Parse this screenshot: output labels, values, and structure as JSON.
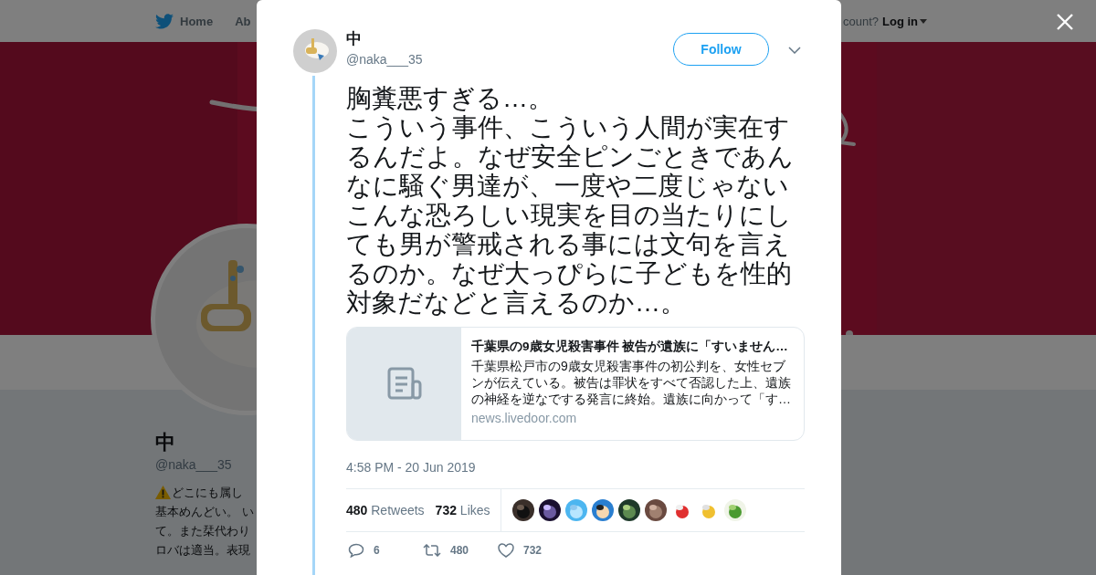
{
  "background_page": {
    "nav": {
      "items": [
        {
          "kind": "home",
          "label": "Home"
        },
        {
          "kind": "plain",
          "label": "Ab"
        }
      ],
      "account_prompt": "count?",
      "login": "Log in"
    },
    "profile": {
      "name": "中",
      "handle": "@naka___35",
      "bio_lines": [
        "どこにも属し",
        "基本めんどい。 い",
        "て。また栞代わり",
        "ロバは適当。表現"
      ]
    }
  },
  "tweet": {
    "author": {
      "name": "中",
      "handle": "@naka___35"
    },
    "follow_button": "Follow",
    "text_lines": [
      "胸糞悪すぎる…。",
      "こういう事件、こういう人間が実在するんだよ。なぜ安全ピンごときであんなに騒ぐ男達が、一度や二度じゃないこんな恐ろしい現実を目の当たりにしても男が警戒される事には文句を言えるのか。なぜ大っぴらに子どもを性的対象だなどと言えるのか…。"
    ],
    "card": {
      "title": "千葉県の9歳女児殺害事件 被告が遺族に「すいません…",
      "description": "千葉県松戸市の9歳女児殺害事件の初公判を、女性セブンが伝えている。被告は罪状をすべて否認した上、遺族の神経を逆なでする発言に終始。遺族に向かって「す…",
      "domain": "news.livedoor.com"
    },
    "timestamp": "4:58 PM - 20 Jun 2019",
    "stats": [
      {
        "count": "480",
        "label": "Retweets"
      },
      {
        "count": "732",
        "label": "Likes"
      }
    ],
    "liker_avatars": [
      {
        "kind": "picture"
      },
      {
        "kind": "picture"
      },
      {
        "kind": "picture"
      },
      {
        "kind": "picture"
      },
      {
        "kind": "picture"
      },
      {
        "kind": "picture"
      },
      {
        "kind": "picture"
      },
      {
        "kind": "picture"
      },
      {
        "kind": "picture"
      }
    ],
    "actions": [
      {
        "kind": "reply",
        "count": "6"
      },
      {
        "kind": "retweet",
        "count": "480"
      },
      {
        "kind": "like",
        "count": "732"
      }
    ]
  }
}
